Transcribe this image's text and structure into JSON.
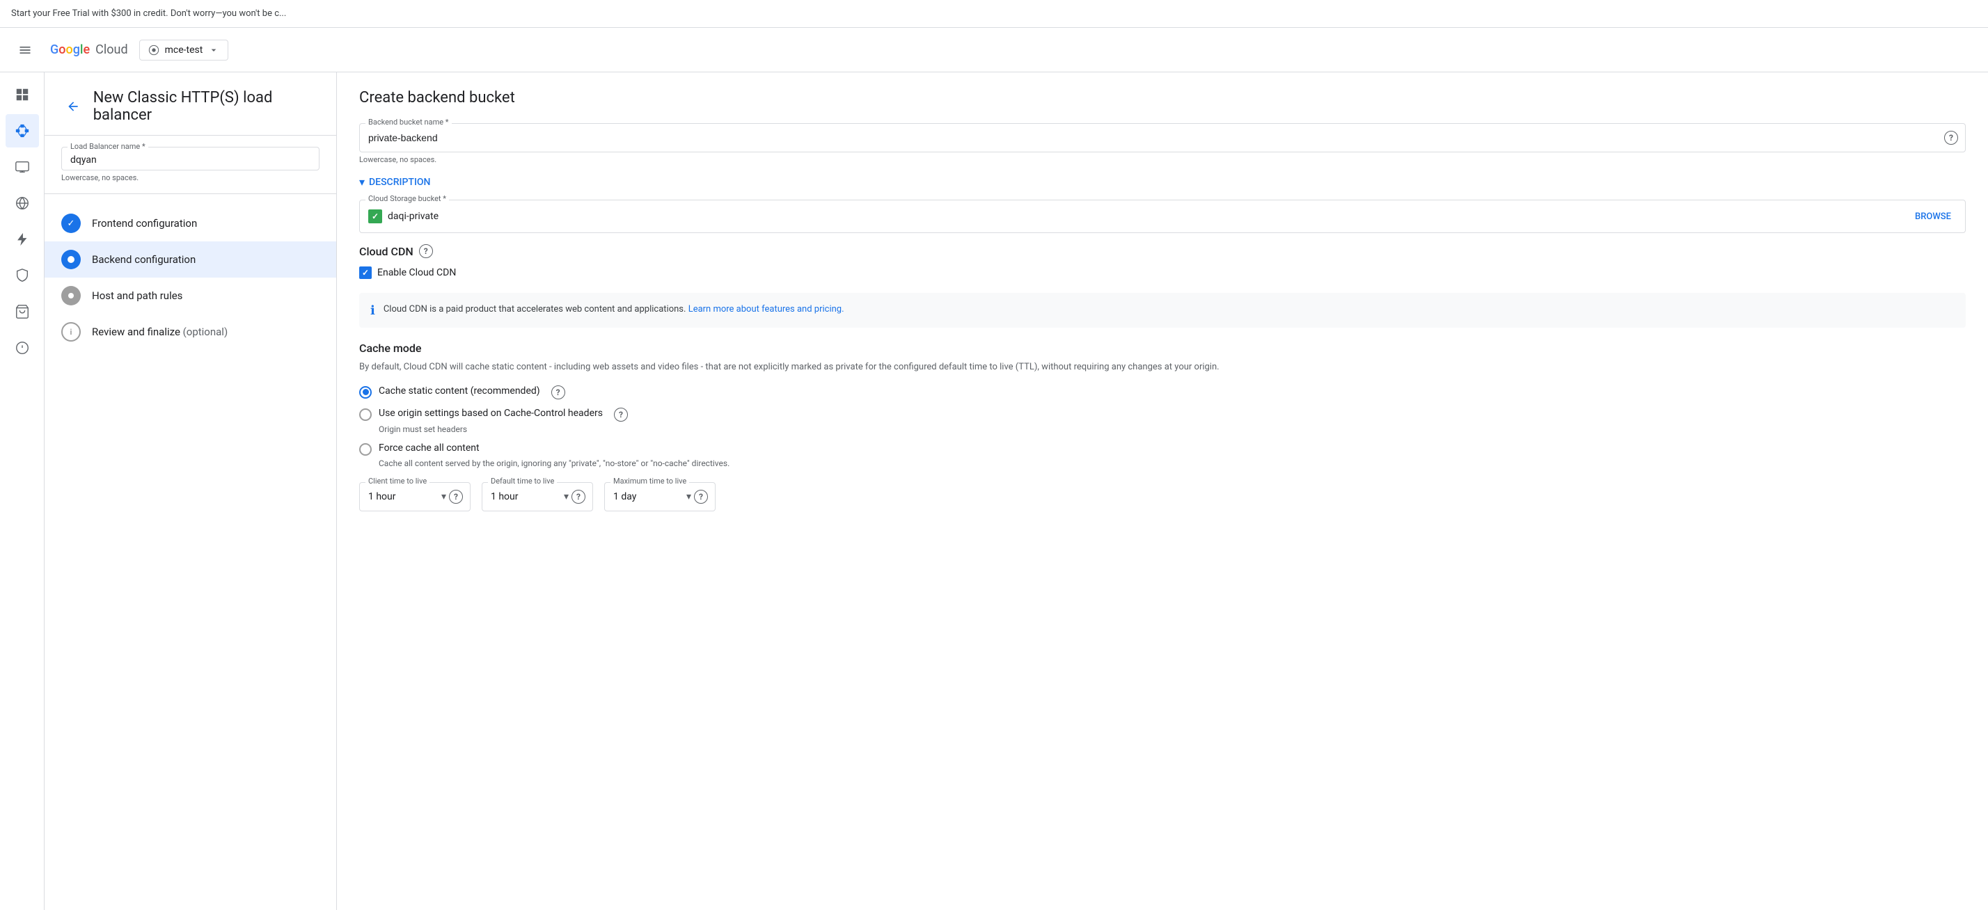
{
  "banner": {
    "text": "Start your Free Trial with $300 in credit. Don't worry—you won't be c..."
  },
  "header": {
    "logo_google": "Google",
    "logo_cloud": "Cloud",
    "project": "mce-test"
  },
  "sidebar": {
    "icons": [
      "grid",
      "menu",
      "network",
      "computer",
      "globe",
      "lightning",
      "shield",
      "cart",
      "info"
    ]
  },
  "page": {
    "title": "New Classic HTTP(S) load balancer"
  },
  "lb_name": {
    "label": "Load Balancer name *",
    "value": "dqyan",
    "hint": "Lowercase, no spaces."
  },
  "steps": [
    {
      "id": "frontend",
      "label": "Frontend configuration",
      "status": "completed",
      "icon_text": "✓"
    },
    {
      "id": "backend",
      "label": "Backend configuration",
      "status": "current",
      "icon_text": "●"
    },
    {
      "id": "hostpath",
      "label": "Host and path rules",
      "status": "pending",
      "icon_text": "●"
    },
    {
      "id": "review",
      "label": "Review and finalize",
      "status": "info",
      "icon_text": "i",
      "optional": "(optional)"
    }
  ],
  "form": {
    "title": "Create backend bucket",
    "backend_bucket_name": {
      "label": "Backend bucket name *",
      "value": "private-backend",
      "hint": "Lowercase, no spaces."
    },
    "description_section": {
      "label": "DESCRIPTION"
    },
    "cloud_storage_bucket": {
      "label": "Cloud Storage bucket *",
      "value": "daqi-private",
      "browse_label": "BROWSE"
    },
    "cloud_cdn": {
      "label": "Cloud CDN",
      "enable_label": "Enable Cloud CDN",
      "info_text": "Cloud CDN is a paid product that accelerates web content and applications.",
      "info_link_text": "Learn more about features and pricing.",
      "info_link_href": "#"
    },
    "cache_mode": {
      "title": "Cache mode",
      "description": "By default, Cloud CDN will cache static content - including web assets and video files - that are not explicitly marked as private for the configured default time to live (TTL), without requiring any changes at your origin.",
      "options": [
        {
          "id": "static",
          "label": "Cache static content (recommended)",
          "selected": true,
          "sub": ""
        },
        {
          "id": "origin",
          "label": "Use origin settings based on Cache-Control headers",
          "selected": false,
          "sub": "Origin must set headers"
        },
        {
          "id": "force",
          "label": "Force cache all content",
          "selected": false,
          "sub": "Cache all content served by the origin, ignoring any \"private\", \"no-store\" or \"no-cache\" directives."
        }
      ]
    },
    "ttl_fields": [
      {
        "id": "client_ttl",
        "label": "Client time to live",
        "value": "1 hour"
      },
      {
        "id": "default_ttl",
        "label": "Default time to live",
        "value": "1 hour"
      },
      {
        "id": "max_ttl",
        "label": "Maximum time to live",
        "value": "1 day"
      }
    ]
  }
}
